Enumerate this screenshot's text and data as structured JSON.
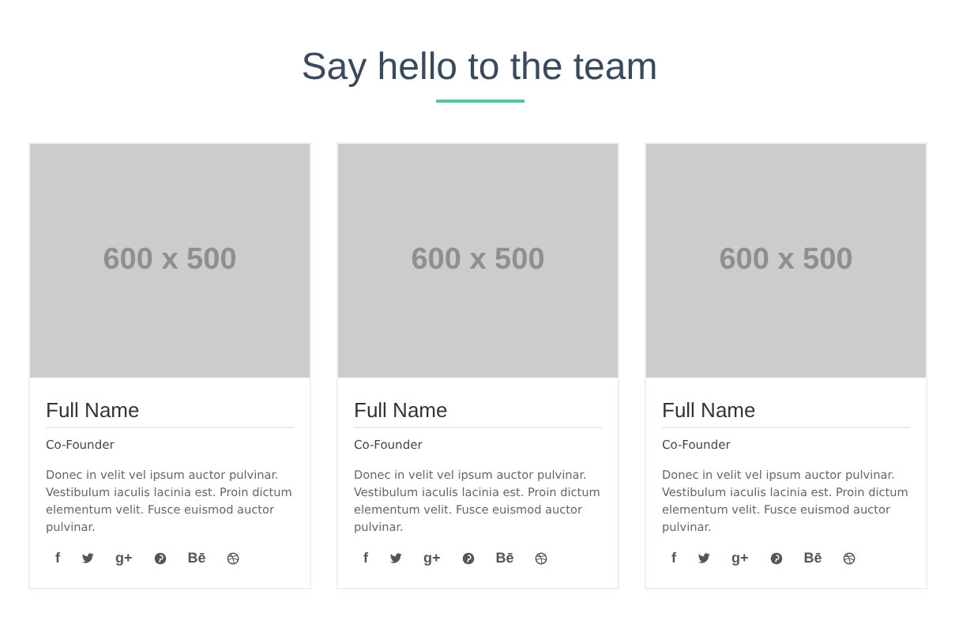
{
  "heading": "Say hello to the team",
  "members": [
    {
      "photo_label": "600 x 500",
      "name": "Full Name",
      "role": "Co-Founder",
      "bio": "Donec in velit vel ipsum auctor pulvinar. Vestibulum iaculis lacinia est. Proin dictum elementum velit. Fusce euismod auctor pulvinar.",
      "social": [
        {
          "kind": "text",
          "label": "f"
        },
        {
          "kind": "bird"
        },
        {
          "kind": "text",
          "label": "g+"
        },
        {
          "kind": "pin"
        },
        {
          "kind": "text",
          "label": "Bē"
        },
        {
          "kind": "ball"
        }
      ]
    },
    {
      "photo_label": "600 x 500",
      "name": "Full Name",
      "role": "Co-Founder",
      "bio": "Donec in velit vel ipsum auctor pulvinar. Vestibulum iaculis lacinia est. Proin dictum elementum velit. Fusce euismod auctor pulvinar.",
      "social": [
        {
          "kind": "text",
          "label": "f"
        },
        {
          "kind": "bird"
        },
        {
          "kind": "text",
          "label": "g+"
        },
        {
          "kind": "pin"
        },
        {
          "kind": "text",
          "label": "Bē"
        },
        {
          "kind": "ball"
        }
      ]
    },
    {
      "photo_label": "600 x 500",
      "name": "Full Name",
      "role": "Co-Founder",
      "bio": "Donec in velit vel ipsum auctor pulvinar. Vestibulum iaculis lacinia est. Proin dictum elementum velit. Fusce euismod auctor pulvinar.",
      "social": [
        {
          "kind": "text",
          "label": "f"
        },
        {
          "kind": "bird"
        },
        {
          "kind": "text",
          "label": "g+"
        },
        {
          "kind": "pin"
        },
        {
          "kind": "text",
          "label": "Bē"
        },
        {
          "kind": "ball"
        }
      ]
    }
  ]
}
